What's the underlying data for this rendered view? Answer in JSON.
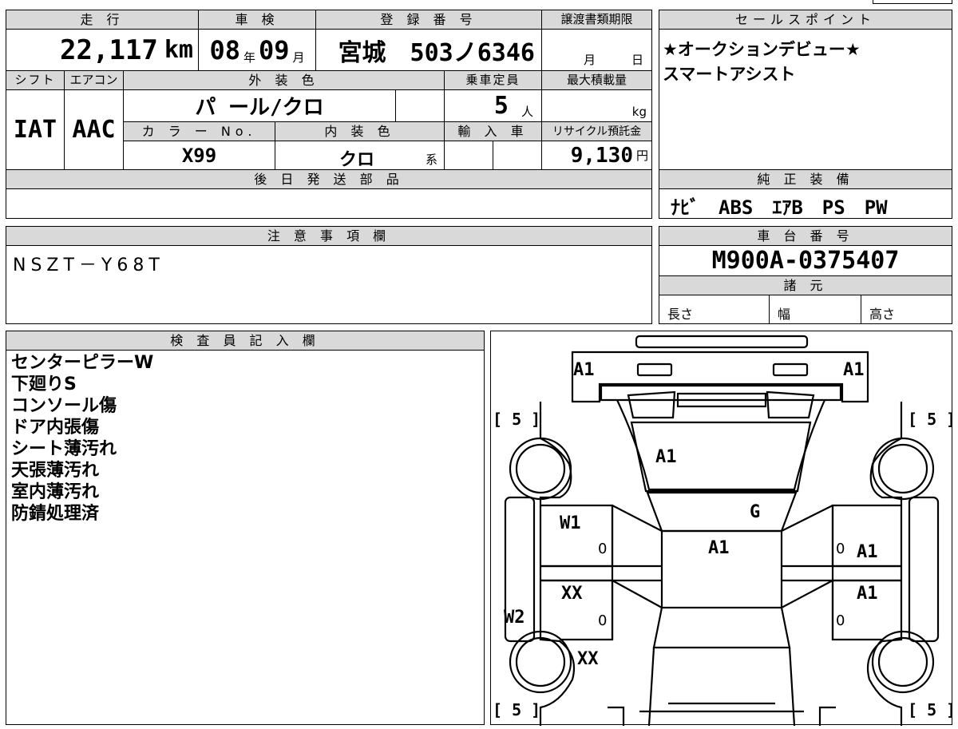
{
  "top": {
    "mileage_header": "走 行",
    "mileage_value": "22,117",
    "mileage_unit": "km",
    "inspection_header": "車 検",
    "inspection_year": "08",
    "year_unit": "年",
    "inspection_month": "09",
    "month_unit": "月",
    "registration_header": "登 録 番 号",
    "registration_value": "宮城　503ノ6346",
    "transfer_header": "譲渡書類期限",
    "transfer_month_unit": "月",
    "transfer_day_unit": "日",
    "shift_header": "シフト",
    "shift_value": "IAT",
    "ac_header": "エアコン",
    "ac_value": "AAC",
    "exterior_header": "外 装 色",
    "exterior_value": "パ ール/クロ",
    "capacity_header": "乗車定員",
    "capacity_value": "5",
    "capacity_unit": "人",
    "max_load_header": "最大積載量",
    "max_load_unit": "kg",
    "color_no_header": "カ ラ ー No.",
    "color_no_value": "X99",
    "interior_header": "内 装 色",
    "interior_value": "クロ",
    "interior_suffix": "系",
    "import_header": "輸 入 車",
    "recycle_header": "リサイクル預託金",
    "recycle_value": "9,130",
    "recycle_unit": "円",
    "later_parts_header": "後 日 発 送 部 品"
  },
  "sales": {
    "header": "セールスポイント",
    "lines": [
      "★オークションデビュー★",
      "スマートアシスト"
    ]
  },
  "equipment": {
    "header": "純 正 装 備",
    "value": "ﾅﾋﾞ　ABS　ｴｱB　PS　PW"
  },
  "notes": {
    "header": "注 意 事 項 欄",
    "value": "NSZT－Y68T"
  },
  "chassis": {
    "header": "車 台 番 号",
    "value": "M900A-0375407",
    "specs_header": "諸 元",
    "length_label": "長さ",
    "width_label": "幅",
    "height_label": "高さ"
  },
  "inspector": {
    "header": "検 査 員 記 入 欄",
    "lines": [
      "センターピラーW",
      "下廻りS",
      "コンソール傷",
      "ドア内張傷",
      "シート薄汚れ",
      "天張薄汚れ",
      "室内薄汚れ",
      "防錆処理済"
    ]
  },
  "diagram": {
    "front_left": "A1",
    "front_right": "A1",
    "hood": "A1",
    "windshield": "G",
    "roof": "A1",
    "front_left_door": "W1",
    "front_left_door_sub": "0",
    "front_right_door": "A1",
    "front_right_door_sub": "0",
    "rear_left_door": "XX",
    "rear_left_door_sub": "0",
    "rear_right_door": "A1",
    "rear_right_door_sub": "0",
    "left_rocker": "W2",
    "rear_left_quarter": "XX",
    "tire_fl": "[ 5 ]",
    "tire_fr": "[ 5 ]",
    "tire_rl": "[ 5 ]",
    "tire_rr": "[ 5 ]"
  }
}
